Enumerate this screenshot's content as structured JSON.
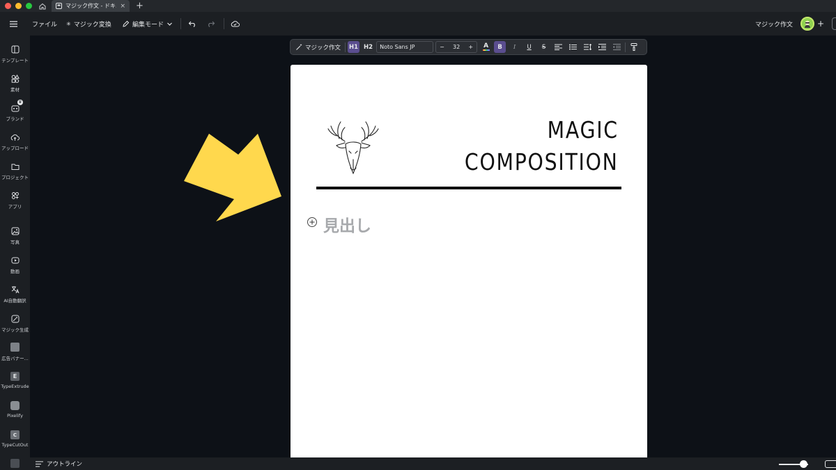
{
  "tabs": {
    "document_tab_title": "マジック作文 - ドキ..."
  },
  "toolbar": {
    "file": "ファイル",
    "magic_switch": "マジック変換",
    "edit_mode": "編集モード",
    "doc_title": "マジック作文"
  },
  "sidebar": {
    "items": [
      {
        "label": "テンプレート",
        "icon": "template-icon"
      },
      {
        "label": "素材",
        "icon": "elements-icon"
      },
      {
        "label": "ブランド",
        "icon": "brand-icon"
      },
      {
        "label": "アップロード",
        "icon": "upload-icon"
      },
      {
        "label": "プロジェクト",
        "icon": "folder-icon"
      },
      {
        "label": "アプリ",
        "icon": "apps-icon"
      },
      {
        "label": "写真",
        "icon": "photo-icon"
      },
      {
        "label": "動画",
        "icon": "video-icon"
      },
      {
        "label": "AI自動翻訳",
        "icon": "translate-icon"
      },
      {
        "label": "マジック生成",
        "icon": "magic-media-icon"
      },
      {
        "label": "広告バナー...",
        "icon": "ad-banner-app"
      },
      {
        "label": "TypeExtrude",
        "icon": "typeextrude-app"
      },
      {
        "label": "Pixelify",
        "icon": "pixelify-app"
      },
      {
        "label": "TypeCutOut",
        "icon": "typecutout-app"
      }
    ]
  },
  "format_bar": {
    "magic_write": "マジック作文",
    "h1": "H1",
    "h2": "H2",
    "font": "Noto Sans JP",
    "font_size": "32",
    "minus": "−",
    "plus": "+",
    "bold": "B",
    "italic": "I",
    "underline": "U",
    "strike": "S"
  },
  "document": {
    "title_line1": "MAGIC",
    "title_line2": "COMPOSITION",
    "heading_placeholder": "見出し"
  },
  "bottom": {
    "outline": "アウトライン"
  },
  "colors": {
    "accent": "#5a4d8f",
    "arrow": "#ffd84d",
    "avatar": "#8fd14f"
  }
}
